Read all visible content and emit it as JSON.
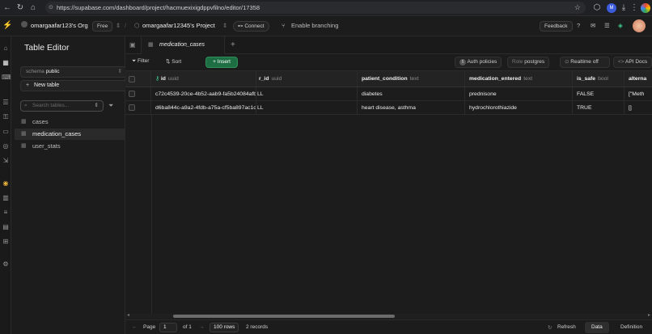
{
  "browser": {
    "url": "https://supabase.com/dashboard/project/hacmuexixigdppvfilno/editor/17358"
  },
  "header": {
    "org": "omargaafar123's Org",
    "plan": "Free",
    "project": "omargaafar12345's Project",
    "connect": "Connect",
    "branching": "Enable branching",
    "feedback": "Feedback"
  },
  "sidebar": {
    "title": "Table Editor",
    "schema_label": "schema",
    "schema_value": "public",
    "new_table": "New table",
    "search_placeholder": "Search tables...",
    "tables": [
      "cases",
      "medication_cases",
      "user_stats"
    ],
    "active_table": "medication_cases"
  },
  "tab": {
    "label": "medication_cases"
  },
  "toolbar": {
    "filter": "Filter",
    "sort": "Sort",
    "insert": "Insert",
    "auth_policies": "Auth policies",
    "auth_count": "5",
    "role_label": "Role",
    "role_value": "postgres",
    "realtime": "Realtime off",
    "api_docs": "API Docs"
  },
  "grid": {
    "columns": [
      {
        "name": "id",
        "type": "uuid"
      },
      {
        "name": "r_id",
        "type": "uuid"
      },
      {
        "name": "patient_condition",
        "type": "text"
      },
      {
        "name": "medication_entered",
        "type": "text"
      },
      {
        "name": "is_safe",
        "type": "bool"
      },
      {
        "name": "alterna",
        "type": ""
      }
    ],
    "rows": [
      [
        "c72c4539-20ce-4b52-aab9-fa5b24084afb",
        "LL",
        "diabetes",
        "prednisone",
        "FALSE",
        "[\"Meth"
      ],
      [
        "d6ba844c-a9a2-4fdb-a75a-cf5ba897ac1c",
        "LL",
        "heart disease, asthma",
        "hydrochlorothiazide",
        "TRUE",
        "[]"
      ]
    ]
  },
  "footer": {
    "page_label": "Page",
    "page_value": "1",
    "of": "of 1",
    "rows": "100 rows",
    "records": "2 records",
    "refresh": "Refresh",
    "data": "Data",
    "definition": "Definition"
  },
  "colors": {
    "accent": "#3ecf8e",
    "insert_bg": "#1d6f43"
  }
}
